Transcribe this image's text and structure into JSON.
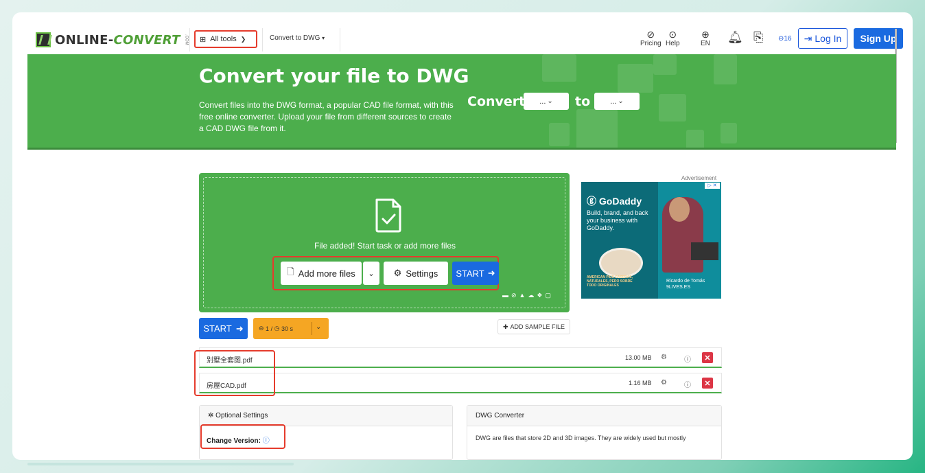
{
  "header": {
    "logo_text_main": "ONLINE-",
    "logo_text_accent": "CONVERT",
    "logo_small": ".COM",
    "all_tools": "All tools",
    "all_tools_icon": "grid-icon",
    "convert_to": "Convert to DWG",
    "pricing": "Pricing",
    "help": "Help",
    "language": "EN",
    "credits_badge": "16",
    "login": "Log In",
    "signup": "Sign Up"
  },
  "banner": {
    "title": "Convert your file to DWG",
    "description": "Convert files into the DWG format, a popular CAD file format, with this free online converter. Upload your file from different sources to create a CAD DWG file from it.",
    "convert_label": "Convert",
    "to_label": "to",
    "from_select": "...",
    "to_select": "..."
  },
  "dropzone": {
    "status": "File added! Start task or add more files",
    "add_more": "Add more files",
    "settings": "Settings",
    "start": "START"
  },
  "ad": {
    "label": "Advertisement",
    "brand": "GoDaddy",
    "tagline": "Build, brand, and back your business with GoDaddy.",
    "caption_line1": "Ricardo de Tomás",
    "caption_line2": "9LIVES.ES",
    "product_text": "AMERICAN PIES CASERAS, NATURALES, PERO SOBRE TODO ORIGINALES"
  },
  "actions": {
    "start": "START",
    "credits": "1",
    "time": "30 s",
    "add_sample": "ADD SAMPLE FILE"
  },
  "files": [
    {
      "name": "别墅全套图.pdf",
      "size": "13.00 MB"
    },
    {
      "name": "房屋CAD.pdf",
      "size": "1.16 MB"
    }
  ],
  "optional_settings": {
    "title": "Optional Settings",
    "change_version": "Change Version:"
  },
  "dwg_converter": {
    "title": "DWG Converter",
    "text": "DWG are files that store 2D and 3D images. They are widely used but mostly"
  },
  "colors": {
    "green": "#4cae4c",
    "blue": "#1a6ae0",
    "highlight": "#e53b2c",
    "orange": "#f5a623"
  }
}
